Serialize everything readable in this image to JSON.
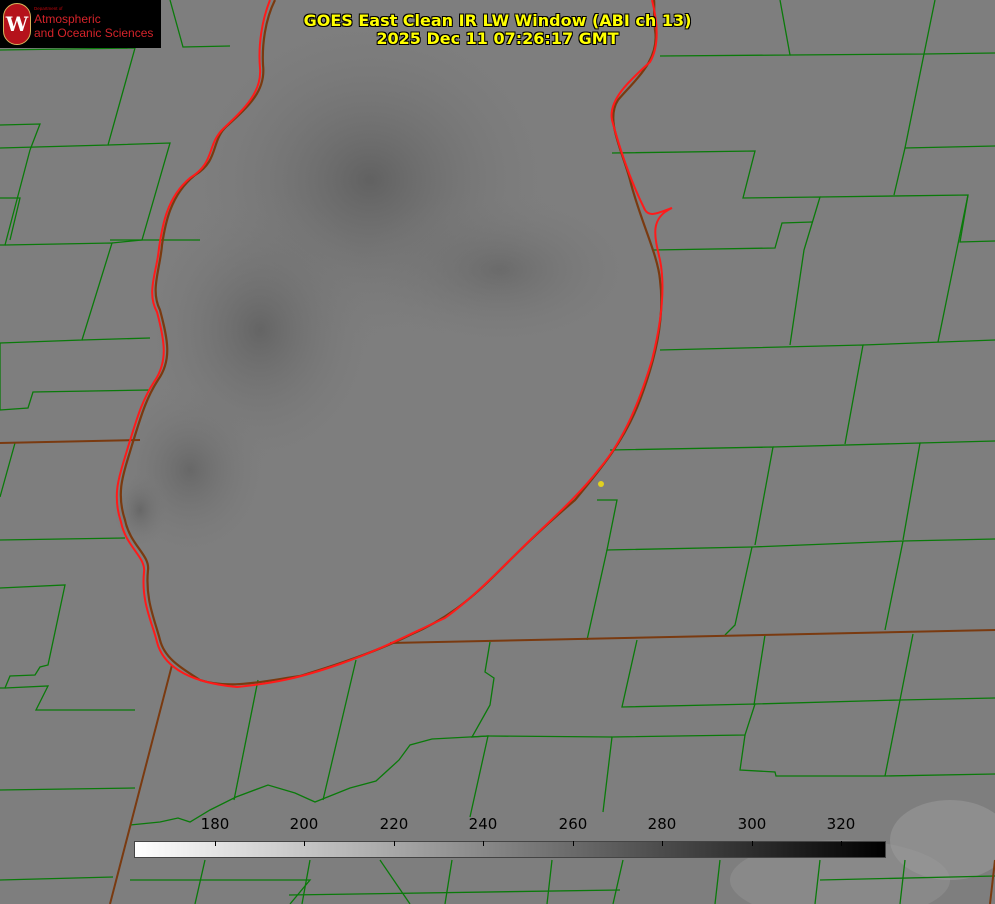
{
  "title": {
    "line1": "GOES East Clean IR LW Window (ABI ch 13)",
    "line2": "2025 Dec 11 07:26:17 GMT"
  },
  "logo": {
    "dept": "Department of",
    "line1": "Atmospheric",
    "line2": "and Oceanic Sciences",
    "seal_letter": "W"
  },
  "colorbar": {
    "ticks": [
      "180",
      "200",
      "220",
      "240",
      "260",
      "280",
      "300",
      "320"
    ],
    "colors": {
      "low": "#ffffff",
      "high": "#000000"
    }
  },
  "colors": {
    "lake_outline": "#ff1a1a",
    "county_lines": "#0a7a0a",
    "state_lines": "#7a3a10",
    "title_text": "#ffff00",
    "marker": "#e0d020"
  }
}
